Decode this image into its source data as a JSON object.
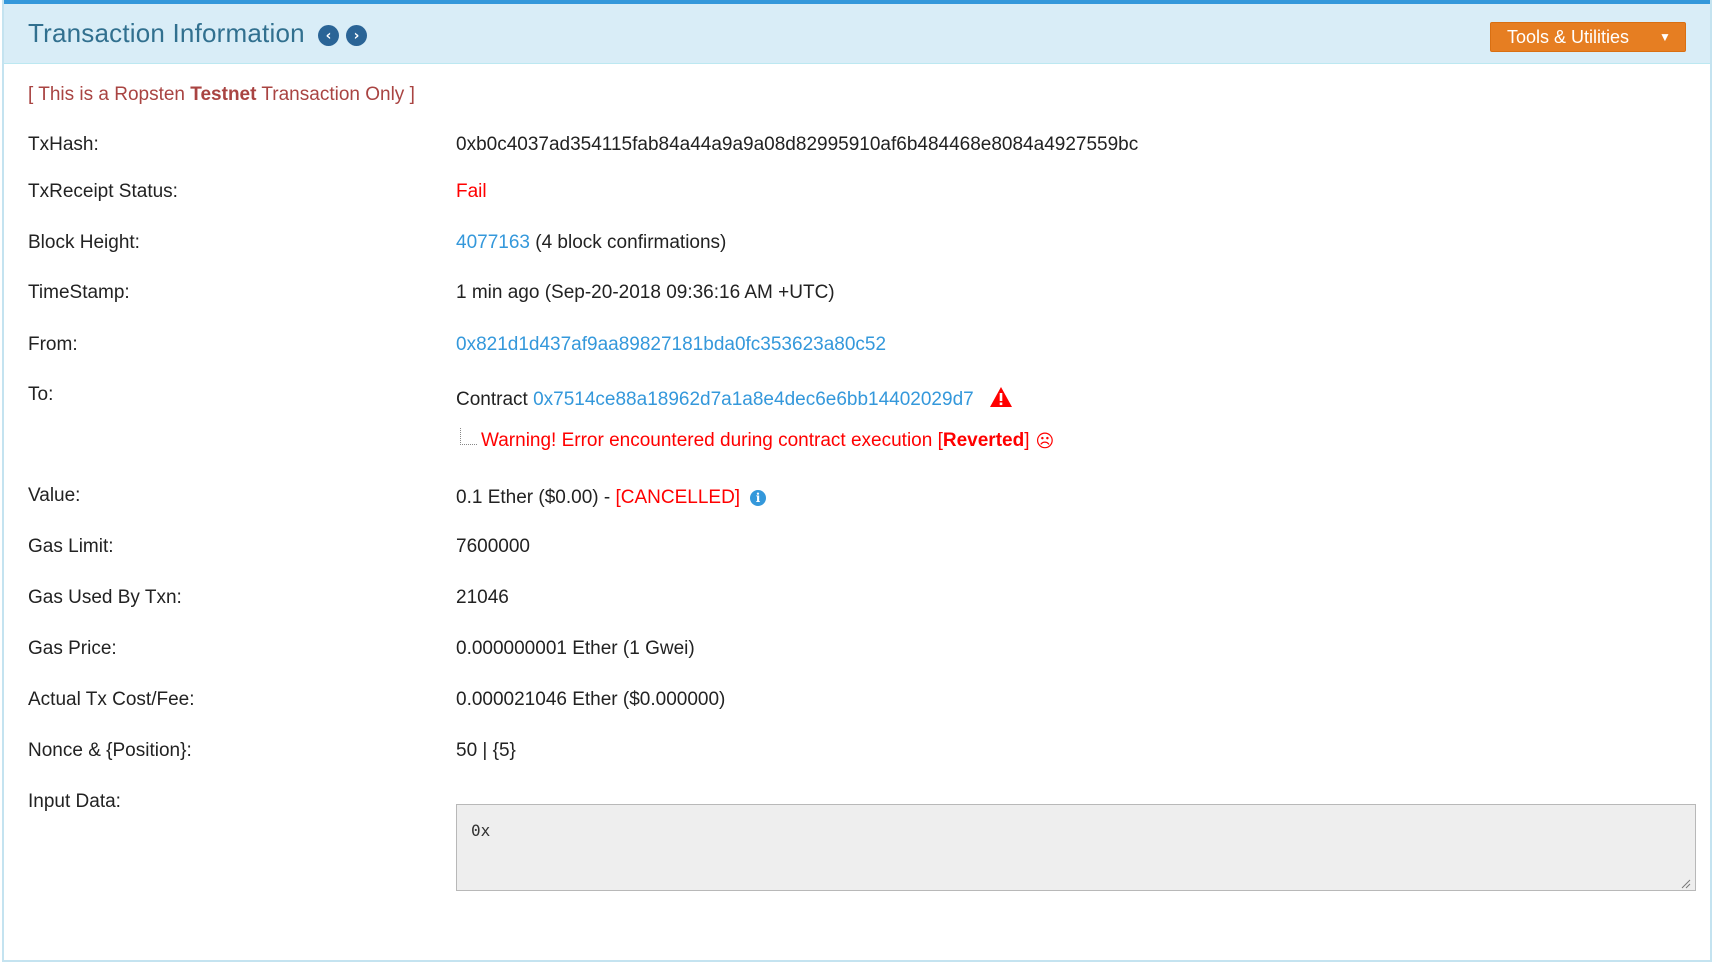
{
  "header": {
    "title": "Transaction Information",
    "prev_icon": "chevron-left-circle-icon",
    "next_icon": "chevron-right-circle-icon",
    "tools_label": "Tools & Utilities"
  },
  "notice": {
    "prefix": "[ This is a Ropsten ",
    "bold": "Testnet",
    "suffix": " Transaction Only ]"
  },
  "fields": {
    "txhash": {
      "label": "TxHash:",
      "value": "0xb0c4037ad354115fab84a44a9a9a08d82995910af6b484468e8084a4927559bc"
    },
    "status": {
      "label": "TxReceipt Status:",
      "value": "Fail"
    },
    "block": {
      "label": "Block Height:",
      "link": "4077163",
      "suffix": " (4 block confirmations)"
    },
    "timestamp": {
      "label": "TimeStamp:",
      "value": "1 min ago (Sep-20-2018 09:36:16 AM +UTC)"
    },
    "from": {
      "label": "From:",
      "value": "0x821d1d437af9aa89827181bda0fc353623a80c52"
    },
    "to": {
      "label": "To:",
      "prefix": "Contract ",
      "link": "0x7514ce88a18962d7a1a8e4dec6e6bb14402029d7",
      "warning_prefix": "Warning! Error encountered during contract execution [",
      "warning_bold": "Reverted",
      "warning_suffix": "]"
    },
    "value": {
      "label": "Value:",
      "value": "0.1 Ether ($0.00) - ",
      "cancelled": "[CANCELLED]"
    },
    "gas_limit": {
      "label": "Gas Limit:",
      "value": "7600000"
    },
    "gas_used": {
      "label": "Gas Used By Txn:",
      "value": "21046"
    },
    "gas_price": {
      "label": "Gas Price:",
      "value": "0.000000001 Ether (1 Gwei)"
    },
    "tx_fee": {
      "label": "Actual Tx Cost/Fee:",
      "value": "0.000021046 Ether ($0.000000)"
    },
    "nonce": {
      "label": "Nonce & {Position}:",
      "value": "50 | {5}"
    },
    "input": {
      "label": "Input Data:",
      "value": "0x"
    }
  },
  "colors": {
    "header_bg": "#d9edf7",
    "header_text": "#31708f",
    "accent_top": "#3498db",
    "button": "#e67e22",
    "link": "#3498db",
    "error": "#ff0000",
    "notice": "#a94442"
  }
}
